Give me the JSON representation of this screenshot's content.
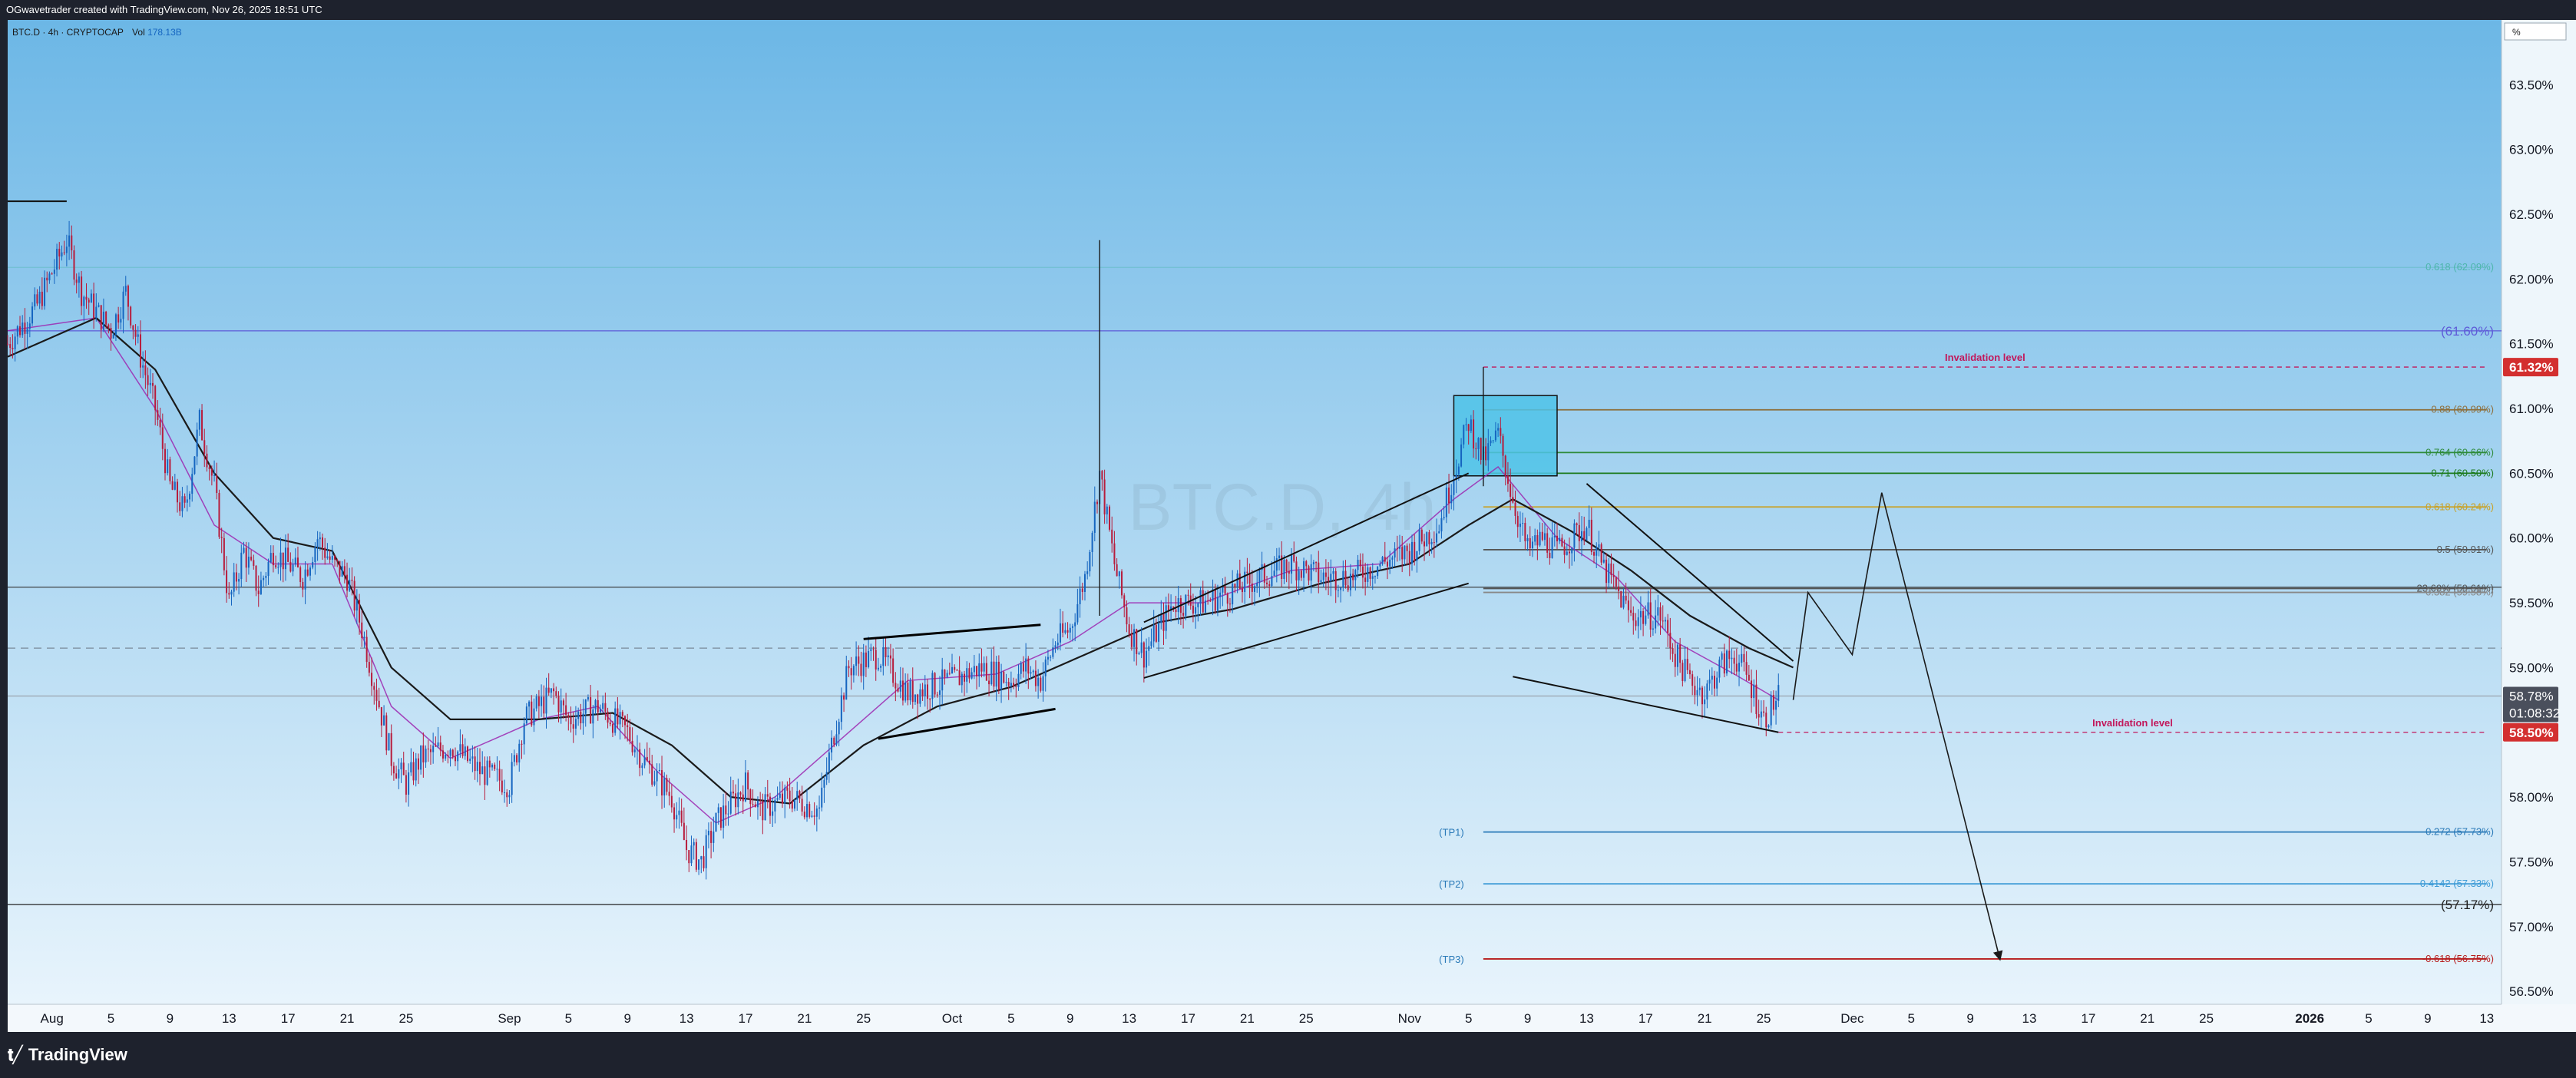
{
  "header": {
    "credit": "OGwavetrader created with TradingView.com, Nov 26, 2025 18:51 UTC"
  },
  "footer": {
    "brand": "TradingView"
  },
  "colors": {
    "bg_top": "#6cb7e6",
    "bg_bottom": "#e8f4fc",
    "frame": "#1e222d",
    "candle_up": "#1565c0",
    "candle_down": "#b71c3c",
    "ma_slow": "#1a1a1a",
    "ma_fast": "#9c27b0",
    "invalidation": "#c2185b",
    "price_badge": "#d32f2f",
    "current_badge": "#4a4f5c"
  },
  "chart_data": {
    "type": "candlestick",
    "symbol": "BTC.D · 4h · CRYPTOCAP",
    "volume_label": "Vol",
    "volume_value": "178.13B",
    "watermark": "BTC.D, 4h",
    "unit_button": "%",
    "y_unit": "%",
    "ylim": [
      56.4,
      64.0
    ],
    "y_ticks": [
      {
        "v": 63.5,
        "label": "63.50%"
      },
      {
        "v": 63.0,
        "label": "63.00%"
      },
      {
        "v": 62.5,
        "label": "62.50%"
      },
      {
        "v": 62.0,
        "label": "62.00%"
      },
      {
        "v": 61.5,
        "label": "61.50%"
      },
      {
        "v": 61.0,
        "label": "61.00%"
      },
      {
        "v": 60.5,
        "label": "60.50%"
      },
      {
        "v": 60.0,
        "label": "60.00%"
      },
      {
        "v": 59.5,
        "label": "59.50%"
      },
      {
        "v": 59.0,
        "label": "59.00%"
      },
      {
        "v": 58.0,
        "label": "58.00%"
      },
      {
        "v": 57.5,
        "label": "57.50%"
      },
      {
        "v": 57.0,
        "label": "57.00%"
      },
      {
        "v": 56.5,
        "label": "56.50%"
      }
    ],
    "x_start": "2025-07-29",
    "x_end": "2026-01-14",
    "x_ticks": [
      {
        "d": "2025-08-01",
        "label": "Aug",
        "bold": false
      },
      {
        "d": "2025-08-05",
        "label": "5",
        "bold": false
      },
      {
        "d": "2025-08-09",
        "label": "9",
        "bold": false
      },
      {
        "d": "2025-08-13",
        "label": "13",
        "bold": false
      },
      {
        "d": "2025-08-17",
        "label": "17",
        "bold": false
      },
      {
        "d": "2025-08-21",
        "label": "21",
        "bold": false
      },
      {
        "d": "2025-08-25",
        "label": "25",
        "bold": false
      },
      {
        "d": "2025-09-01",
        "label": "Sep",
        "bold": false
      },
      {
        "d": "2025-09-05",
        "label": "5",
        "bold": false
      },
      {
        "d": "2025-09-09",
        "label": "9",
        "bold": false
      },
      {
        "d": "2025-09-13",
        "label": "13",
        "bold": false
      },
      {
        "d": "2025-09-17",
        "label": "17",
        "bold": false
      },
      {
        "d": "2025-09-21",
        "label": "21",
        "bold": false
      },
      {
        "d": "2025-09-25",
        "label": "25",
        "bold": false
      },
      {
        "d": "2025-10-01",
        "label": "Oct",
        "bold": false
      },
      {
        "d": "2025-10-05",
        "label": "5",
        "bold": false
      },
      {
        "d": "2025-10-09",
        "label": "9",
        "bold": false
      },
      {
        "d": "2025-10-13",
        "label": "13",
        "bold": false
      },
      {
        "d": "2025-10-17",
        "label": "17",
        "bold": false
      },
      {
        "d": "2025-10-21",
        "label": "21",
        "bold": false
      },
      {
        "d": "2025-10-25",
        "label": "25",
        "bold": false
      },
      {
        "d": "2025-11-01",
        "label": "Nov",
        "bold": false
      },
      {
        "d": "2025-11-05",
        "label": "5",
        "bold": false
      },
      {
        "d": "2025-11-09",
        "label": "9",
        "bold": false
      },
      {
        "d": "2025-11-13",
        "label": "13",
        "bold": false
      },
      {
        "d": "2025-11-17",
        "label": "17",
        "bold": false
      },
      {
        "d": "2025-11-21",
        "label": "21",
        "bold": false
      },
      {
        "d": "2025-11-25",
        "label": "25",
        "bold": false
      },
      {
        "d": "2025-12-01",
        "label": "Dec",
        "bold": false
      },
      {
        "d": "2025-12-05",
        "label": "5",
        "bold": false
      },
      {
        "d": "2025-12-09",
        "label": "9",
        "bold": false
      },
      {
        "d": "2025-12-13",
        "label": "13",
        "bold": false
      },
      {
        "d": "2025-12-17",
        "label": "17",
        "bold": false
      },
      {
        "d": "2025-12-21",
        "label": "21",
        "bold": false
      },
      {
        "d": "2025-12-25",
        "label": "25",
        "bold": false
      },
      {
        "d": "2026-01-01",
        "label": "2026",
        "bold": true
      },
      {
        "d": "2026-01-05",
        "label": "5",
        "bold": false
      },
      {
        "d": "2026-01-09",
        "label": "9",
        "bold": false
      },
      {
        "d": "2026-01-13",
        "label": "13",
        "bold": false
      }
    ],
    "price_path": [
      [
        "2025-07-29",
        61.5
      ],
      [
        "2025-07-31",
        61.8
      ],
      [
        "2025-08-02",
        62.3
      ],
      [
        "2025-08-03",
        61.9
      ],
      [
        "2025-08-05",
        61.6
      ],
      [
        "2025-08-06",
        61.9
      ],
      [
        "2025-08-07",
        61.4
      ],
      [
        "2025-08-08",
        61.0
      ],
      [
        "2025-08-09",
        60.4
      ],
      [
        "2025-08-10",
        60.2
      ],
      [
        "2025-08-11",
        60.9
      ],
      [
        "2025-08-12",
        60.4
      ],
      [
        "2025-08-13",
        59.5
      ],
      [
        "2025-08-14",
        59.9
      ],
      [
        "2025-08-15",
        59.6
      ],
      [
        "2025-08-16",
        59.9
      ],
      [
        "2025-08-18",
        59.7
      ],
      [
        "2025-08-19",
        60.0
      ],
      [
        "2025-08-20",
        59.8
      ],
      [
        "2025-08-21",
        59.7
      ],
      [
        "2025-08-22",
        59.3
      ],
      [
        "2025-08-23",
        58.8
      ],
      [
        "2025-08-24",
        58.3
      ],
      [
        "2025-08-25",
        58.1
      ],
      [
        "2025-08-26",
        58.3
      ],
      [
        "2025-08-28",
        58.4
      ],
      [
        "2025-08-30",
        58.2
      ],
      [
        "2025-09-01",
        58.1
      ],
      [
        "2025-09-02",
        58.6
      ],
      [
        "2025-09-04",
        58.8
      ],
      [
        "2025-09-05",
        58.6
      ],
      [
        "2025-09-07",
        58.7
      ],
      [
        "2025-09-09",
        58.5
      ],
      [
        "2025-09-10",
        58.3
      ],
      [
        "2025-09-12",
        58.0
      ],
      [
        "2025-09-13",
        57.6
      ],
      [
        "2025-09-14",
        57.5
      ],
      [
        "2025-09-15",
        57.8
      ],
      [
        "2025-09-17",
        58.1
      ],
      [
        "2025-09-18",
        57.9
      ],
      [
        "2025-09-20",
        58.0
      ],
      [
        "2025-09-22",
        57.9
      ],
      [
        "2025-09-23",
        58.5
      ],
      [
        "2025-09-24",
        59.0
      ],
      [
        "2025-09-26",
        59.1
      ],
      [
        "2025-09-28",
        58.8
      ],
      [
        "2025-10-01",
        58.9
      ],
      [
        "2025-10-03",
        59.0
      ],
      [
        "2025-10-05",
        58.9
      ],
      [
        "2025-10-06",
        59.0
      ],
      [
        "2025-10-07",
        58.9
      ],
      [
        "2025-10-08",
        59.2
      ],
      [
        "2025-10-09",
        59.3
      ],
      [
        "2025-10-10",
        59.7
      ],
      [
        "2025-10-11",
        60.5
      ],
      [
        "2025-10-12",
        59.8
      ],
      [
        "2025-10-13",
        59.3
      ],
      [
        "2025-10-14",
        59.1
      ],
      [
        "2025-10-16",
        59.5
      ],
      [
        "2025-10-18",
        59.5
      ],
      [
        "2025-10-20",
        59.6
      ],
      [
        "2025-10-22",
        59.7
      ],
      [
        "2025-10-24",
        59.8
      ],
      [
        "2025-10-26",
        59.7
      ],
      [
        "2025-10-28",
        59.7
      ],
      [
        "2025-10-30",
        59.8
      ],
      [
        "2025-11-01",
        59.9
      ],
      [
        "2025-11-03",
        60.1
      ],
      [
        "2025-11-04",
        60.5
      ],
      [
        "2025-11-05",
        60.9
      ],
      [
        "2025-11-06",
        60.6
      ],
      [
        "2025-11-07",
        60.8
      ],
      [
        "2025-11-08",
        60.3
      ],
      [
        "2025-11-09",
        59.9
      ],
      [
        "2025-11-10",
        60.0
      ],
      [
        "2025-11-11",
        59.9
      ],
      [
        "2025-11-12",
        60.0
      ],
      [
        "2025-11-13",
        60.1
      ],
      [
        "2025-11-14",
        59.8
      ],
      [
        "2025-11-15",
        59.6
      ],
      [
        "2025-11-16",
        59.4
      ],
      [
        "2025-11-18",
        59.4
      ],
      [
        "2025-11-19",
        59.1
      ],
      [
        "2025-11-20",
        58.9
      ],
      [
        "2025-11-21",
        58.8
      ],
      [
        "2025-11-22",
        59.0
      ],
      [
        "2025-11-23",
        59.1
      ],
      [
        "2025-11-24",
        58.9
      ],
      [
        "2025-11-25",
        58.6
      ],
      [
        "2025-11-26",
        58.78
      ]
    ],
    "wick_spikes": [
      {
        "date": "2025-10-11",
        "high": 62.3,
        "low": 59.4
      },
      {
        "date": "2025-11-06",
        "high": 61.32,
        "low": 60.4
      }
    ],
    "price_badges": [
      {
        "v": 61.32,
        "label": "61.32%",
        "color": "#d32f2f"
      },
      {
        "v": 58.5,
        "label": "58.50%",
        "color": "#d32f2f"
      }
    ],
    "current_price": {
      "v": 58.78,
      "label": "58.78%",
      "countdown": "01:08:32"
    },
    "horizontal_lines": [
      {
        "v": 61.6,
        "label": "(61.60%)",
        "color": "#5e5bd8",
        "from": "2025-07-29",
        "to": "2026-01-14",
        "label_at": "right",
        "dash": false
      },
      {
        "v": 59.62,
        "label": "",
        "color": "#333333",
        "from": "2025-07-29",
        "to": "2026-01-14",
        "dash": false
      },
      {
        "v": 59.15,
        "label": "",
        "color": "#7a8a99",
        "from": "2025-07-29",
        "to": "2026-01-14",
        "dash": true
      },
      {
        "v": 58.78,
        "label": "",
        "color": "#9aa3ad",
        "from": "2025-07-29",
        "to": "2026-01-14",
        "dash": false
      },
      {
        "v": 57.17,
        "label": "(57.17%)",
        "color": "#222222",
        "from": "2025-07-29",
        "to": "2026-01-14",
        "label_at": "right",
        "dash": false
      }
    ],
    "fib_levels": [
      {
        "v": 62.09,
        "label": "0.618 (62.09%)",
        "color": "#4db6ac",
        "from": "2025-07-29",
        "to": "2026-01-13",
        "faint": true
      },
      {
        "v": 60.99,
        "label": "0.88 (60.99%)",
        "color": "#8d6e3a",
        "from": "2025-11-06",
        "to": "2026-01-13"
      },
      {
        "v": 60.66,
        "label": "0.764 (60.66%)",
        "color": "#2e8b3a",
        "from": "2025-11-06",
        "to": "2026-01-13"
      },
      {
        "v": 60.5,
        "label": "0.71 (60.50%)",
        "color": "#1b7a1b",
        "from": "2025-11-06",
        "to": "2026-01-13"
      },
      {
        "v": 60.24,
        "label": "0.618 (60.24%)",
        "color": "#c9a227",
        "from": "2025-11-06",
        "to": "2026-01-13"
      },
      {
        "v": 59.91,
        "label": "0.5 (59.91%)",
        "color": "#555555",
        "from": "2025-11-06",
        "to": "2026-01-13"
      },
      {
        "v": 59.61,
        "label": "23.60% (59.61%)",
        "color": "#555555",
        "from": "2025-11-06",
        "to": "2026-01-13"
      },
      {
        "v": 59.58,
        "label": "0.382 (59.58%)",
        "color": "#888888",
        "from": "2025-11-06",
        "to": "2026-01-13"
      },
      {
        "v": 57.73,
        "label": "-0.272 (57.73%)",
        "color": "#2a7ab8",
        "from": "2025-11-06",
        "to": "2026-01-13"
      },
      {
        "v": 57.33,
        "label": "-0.4142 (57.33%)",
        "color": "#3d9bd6",
        "from": "2025-11-06",
        "to": "2026-01-13"
      },
      {
        "v": 56.75,
        "label": "-0.618 (56.75%)",
        "color": "#b71c1c",
        "from": "2025-11-06",
        "to": "2026-01-13"
      }
    ],
    "targets": [
      {
        "v": 57.73,
        "label": "(TP1)"
      },
      {
        "v": 57.33,
        "label": "(TP2)"
      },
      {
        "v": 56.75,
        "label": "(TP3)"
      }
    ],
    "invalidation_levels": [
      {
        "v": 61.32,
        "label": "Invalidation level",
        "from": "2025-11-06",
        "to": "2026-01-13"
      },
      {
        "v": 58.5,
        "label": "Invalidation level",
        "from": "2025-11-26",
        "to": "2026-01-13"
      }
    ],
    "channels": [
      {
        "points": [
          [
            "2025-09-25",
            59.22
          ],
          [
            "2025-10-07",
            59.33
          ]
        ],
        "color": "#000000",
        "width": 3
      },
      {
        "points": [
          [
            "2025-09-26",
            58.45
          ],
          [
            "2025-10-08",
            58.68
          ]
        ],
        "color": "#000000",
        "width": 3
      },
      {
        "points": [
          [
            "2025-10-14",
            59.35
          ],
          [
            "2025-11-05",
            60.5
          ]
        ],
        "color": "#111111",
        "width": 2
      },
      {
        "points": [
          [
            "2025-10-14",
            58.92
          ],
          [
            "2025-11-05",
            59.65
          ]
        ],
        "color": "#111111",
        "width": 2
      },
      {
        "points": [
          [
            "2025-11-13",
            60.42
          ],
          [
            "2025-11-27",
            59.05
          ]
        ],
        "color": "#111111",
        "width": 2
      },
      {
        "points": [
          [
            "2025-11-08",
            58.93
          ],
          [
            "2025-11-26",
            58.5
          ]
        ],
        "color": "#111111",
        "width": 2
      },
      {
        "points": [
          [
            "2025-07-29",
            62.6
          ],
          [
            "2025-08-02",
            62.6
          ]
        ],
        "color": "#111111",
        "width": 2
      }
    ],
    "box": {
      "from": "2025-11-04",
      "to": "2025-11-11",
      "top": 61.1,
      "bottom": 60.48,
      "fill": "#4fc3e8",
      "stroke": "#111111"
    },
    "projection": [
      [
        "2025-11-27",
        58.75
      ],
      [
        "2025-11-28",
        59.58
      ],
      [
        "2025-12-01",
        59.1
      ],
      [
        "2025-12-03",
        60.35
      ],
      [
        "2025-12-11",
        56.75
      ]
    ],
    "ma_fast_points": [
      [
        "2025-07-29",
        61.6
      ],
      [
        "2025-08-04",
        61.7
      ],
      [
        "2025-08-08",
        61.0
      ],
      [
        "2025-08-12",
        60.1
      ],
      [
        "2025-08-16",
        59.8
      ],
      [
        "2025-08-20",
        59.8
      ],
      [
        "2025-08-24",
        58.7
      ],
      [
        "2025-08-28",
        58.3
      ],
      [
        "2025-09-03",
        58.6
      ],
      [
        "2025-09-07",
        58.7
      ],
      [
        "2025-09-11",
        58.2
      ],
      [
        "2025-09-15",
        57.8
      ],
      [
        "2025-09-19",
        58.0
      ],
      [
        "2025-09-23",
        58.4
      ],
      [
        "2025-09-28",
        58.9
      ],
      [
        "2025-10-04",
        58.95
      ],
      [
        "2025-10-09",
        59.2
      ],
      [
        "2025-10-13",
        59.5
      ],
      [
        "2025-10-18",
        59.5
      ],
      [
        "2025-10-24",
        59.75
      ],
      [
        "2025-10-30",
        59.8
      ],
      [
        "2025-11-04",
        60.3
      ],
      [
        "2025-11-07",
        60.55
      ],
      [
        "2025-11-11",
        60.0
      ],
      [
        "2025-11-15",
        59.7
      ],
      [
        "2025-11-19",
        59.2
      ],
      [
        "2025-11-23",
        58.95
      ],
      [
        "2025-11-26",
        58.75
      ]
    ],
    "ma_slow_points": [
      [
        "2025-07-29",
        61.4
      ],
      [
        "2025-08-04",
        61.7
      ],
      [
        "2025-08-08",
        61.3
      ],
      [
        "2025-08-12",
        60.5
      ],
      [
        "2025-08-16",
        60.0
      ],
      [
        "2025-08-20",
        59.9
      ],
      [
        "2025-08-24",
        59.0
      ],
      [
        "2025-08-28",
        58.6
      ],
      [
        "2025-09-03",
        58.6
      ],
      [
        "2025-09-08",
        58.65
      ],
      [
        "2025-09-12",
        58.4
      ],
      [
        "2025-09-16",
        58.0
      ],
      [
        "2025-09-20",
        57.95
      ],
      [
        "2025-09-25",
        58.4
      ],
      [
        "2025-09-30",
        58.7
      ],
      [
        "2025-10-05",
        58.85
      ],
      [
        "2025-10-10",
        59.1
      ],
      [
        "2025-10-15",
        59.35
      ],
      [
        "2025-10-20",
        59.45
      ],
      [
        "2025-10-26",
        59.65
      ],
      [
        "2025-11-01",
        59.8
      ],
      [
        "2025-11-05",
        60.1
      ],
      [
        "2025-11-08",
        60.3
      ],
      [
        "2025-11-12",
        60.05
      ],
      [
        "2025-11-16",
        59.75
      ],
      [
        "2025-11-20",
        59.4
      ],
      [
        "2025-11-24",
        59.15
      ],
      [
        "2025-11-27",
        59.0
      ]
    ]
  }
}
